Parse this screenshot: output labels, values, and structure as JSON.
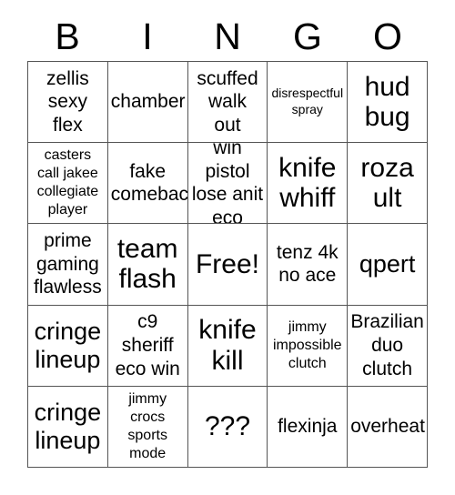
{
  "card": {
    "title": "BINGO",
    "headers": [
      "B",
      "I",
      "N",
      "G",
      "O"
    ],
    "rows": [
      [
        {
          "text": "zellis\nsexy\nflex",
          "size": "fs-md"
        },
        {
          "text": "chamber",
          "size": "fs-md"
        },
        {
          "text": "scuffed\nwalk\nout",
          "size": "fs-md"
        },
        {
          "text": "disrespectful\nspray",
          "size": "fs-xs"
        },
        {
          "text": "hud\nbug",
          "size": "fs-xl"
        }
      ],
      [
        {
          "text": "casters\ncall jakee\ncollegiate\nplayer",
          "size": "fs-sm"
        },
        {
          "text": "fake\ncomeback",
          "size": "fs-md"
        },
        {
          "text": "win pistol\nlose anit\neco",
          "size": "fs-md"
        },
        {
          "text": "knife\nwhiff",
          "size": "fs-xl"
        },
        {
          "text": "roza\nult",
          "size": "fs-xl"
        }
      ],
      [
        {
          "text": "prime\ngaming\nflawless",
          "size": "fs-md"
        },
        {
          "text": "team\nflash",
          "size": "fs-xl"
        },
        {
          "text": "Free!",
          "size": "fs-xl"
        },
        {
          "text": "tenz 4k\nno ace",
          "size": "fs-md"
        },
        {
          "text": "qpert",
          "size": "fs-lg"
        }
      ],
      [
        {
          "text": "cringe\nlineup",
          "size": "fs-lg"
        },
        {
          "text": "c9\nsheriff\neco win",
          "size": "fs-md"
        },
        {
          "text": "knife\nkill",
          "size": "fs-xl"
        },
        {
          "text": "jimmy\nimpossible\nclutch",
          "size": "fs-sm"
        },
        {
          "text": "Brazilian\nduo\nclutch",
          "size": "fs-md"
        }
      ],
      [
        {
          "text": "cringe\nlineup",
          "size": "fs-lg"
        },
        {
          "text": "jimmy\ncrocs\nsports\nmode",
          "size": "fs-sm"
        },
        {
          "text": "???",
          "size": "fs-xl"
        },
        {
          "text": "flexinja",
          "size": "fs-md"
        },
        {
          "text": "overheat",
          "size": "fs-md"
        }
      ]
    ],
    "free_space": {
      "row": 2,
      "col": 2,
      "label": "Free!"
    },
    "colors": {
      "background": "#ffffff",
      "text": "#000000",
      "border": "#555555"
    }
  }
}
